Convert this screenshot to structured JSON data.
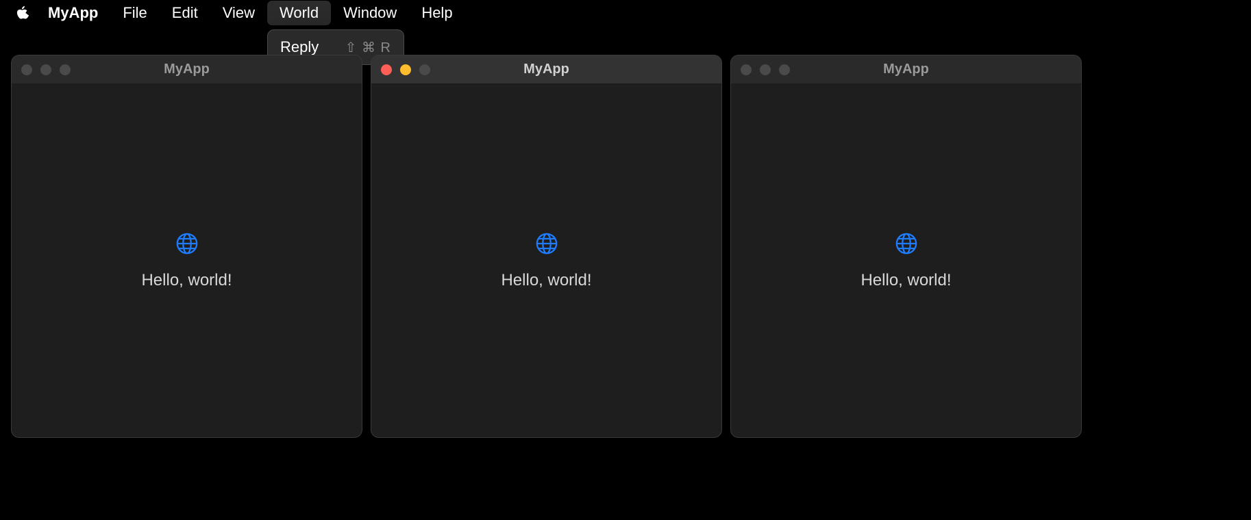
{
  "menubar": {
    "app": "MyApp",
    "items": [
      "File",
      "Edit",
      "View",
      "World",
      "Window",
      "Help"
    ],
    "active_index": 3
  },
  "dropdown": {
    "items": [
      {
        "label": "Reply",
        "shortcut": "⇧ ⌘ R"
      }
    ]
  },
  "windows": [
    {
      "title": "MyApp",
      "body": "Hello, world!",
      "focused": false
    },
    {
      "title": "MyApp",
      "body": "Hello, world!",
      "focused": true
    },
    {
      "title": "MyApp",
      "body": "Hello, world!",
      "focused": false
    }
  ]
}
